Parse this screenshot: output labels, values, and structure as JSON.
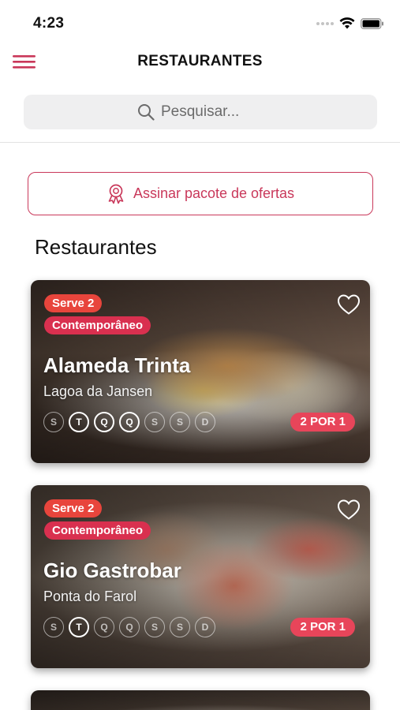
{
  "status_bar": {
    "time": "4:23"
  },
  "nav": {
    "title": "RESTAURANTES",
    "menu_icon": "hamburger-menu-icon"
  },
  "search": {
    "placeholder": "Pesquisar...",
    "value": "",
    "icon": "search-icon"
  },
  "offer_button": {
    "label": "Assinar pacote de ofertas",
    "icon": "award-ribbon-icon"
  },
  "section": {
    "title": "Restaurantes"
  },
  "colors": {
    "accent": "#c9385a",
    "serve_badge": "#e8453c",
    "category_badge": "#d9304f",
    "promo_badge": "#e8455a"
  },
  "restaurants": [
    {
      "serve": "Serve 2",
      "category": "Contemporâneo",
      "name": "Alameda Trinta",
      "location": "Lagoa da Jansen",
      "promo": "2 POR 1",
      "days": [
        {
          "letter": "S",
          "active": false
        },
        {
          "letter": "T",
          "active": true
        },
        {
          "letter": "Q",
          "active": true
        },
        {
          "letter": "Q",
          "active": true
        },
        {
          "letter": "S",
          "active": false
        },
        {
          "letter": "S",
          "active": false
        },
        {
          "letter": "D",
          "active": false
        }
      ]
    },
    {
      "serve": "Serve 2",
      "category": "Contemporâneo",
      "name": "Gio Gastrobar",
      "location": "Ponta do Farol",
      "promo": "2 POR 1",
      "days": [
        {
          "letter": "S",
          "active": false
        },
        {
          "letter": "T",
          "active": true
        },
        {
          "letter": "Q",
          "active": false
        },
        {
          "letter": "Q",
          "active": false
        },
        {
          "letter": "S",
          "active": false
        },
        {
          "letter": "S",
          "active": false
        },
        {
          "letter": "D",
          "active": false
        }
      ]
    }
  ]
}
